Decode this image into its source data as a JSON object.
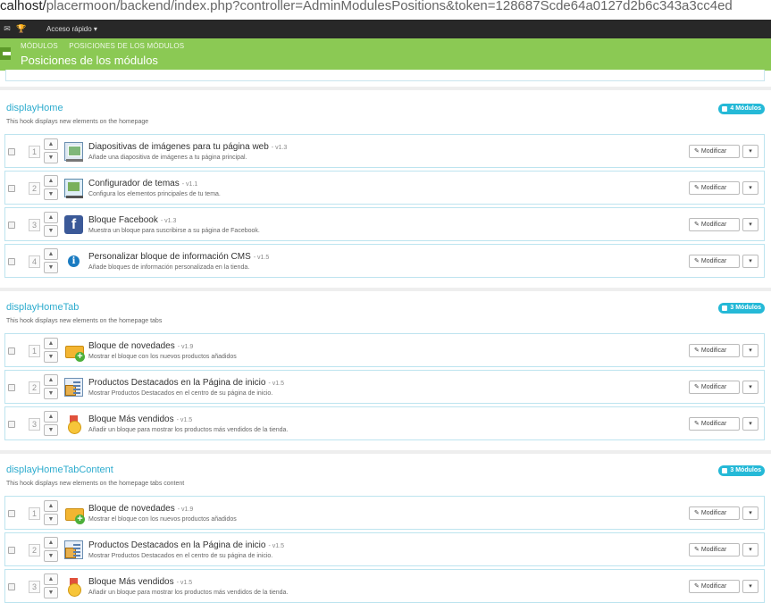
{
  "browser": {
    "url_prefix": "calhost/",
    "url_rest": "placermoon/backend/index.php?controller=AdminModulesPositions&token=128687Scde64a0127d2b6c343a3cc4ed"
  },
  "topbar": {
    "quick_access": "Acceso rápido ▾"
  },
  "header": {
    "breadcrumb": [
      "MÓDULOS",
      "POSICIONES DE LOS MÓDULOS"
    ],
    "title": "Posiciones de los módulos"
  },
  "colors": {
    "accent": "#25b9d7",
    "header_green": "#8bc954",
    "link": "#2eacce"
  },
  "sections": [
    {
      "hook": "displayHome",
      "description": "This hook displays new elements on the homepage",
      "badge": "4 Módulos",
      "modules": [
        {
          "pos": "1",
          "icon": "slideshow-icon",
          "name": "Diapositivas de imágenes para tu página web",
          "version": "- v1.3",
          "desc": "Añade una diapositiva de imágenes a tu página principal.",
          "button": "Modificar"
        },
        {
          "pos": "2",
          "icon": "theme-configurator-icon",
          "name": "Configurador de temas",
          "version": "- v1.1",
          "desc": "Configura los elementos principales de tu tema.",
          "button": "Modificar"
        },
        {
          "pos": "3",
          "icon": "facebook-icon",
          "name": "Bloque Facebook",
          "version": "- v1.3",
          "desc": "Muestra un bloque para suscribirse a su página de Facebook.",
          "button": "Modificar"
        },
        {
          "pos": "4",
          "icon": "info-icon",
          "name": "Personalizar bloque de información CMS",
          "version": "- v1.5",
          "desc": "Añade bloques de información personalizada en la tienda.",
          "button": "Modificar"
        }
      ]
    },
    {
      "hook": "displayHomeTab",
      "description": "This hook displays new elements on the homepage tabs",
      "badge": "3 Módulos",
      "modules": [
        {
          "pos": "1",
          "icon": "new-products-icon",
          "name": "Bloque de novedades",
          "version": "- v1.9",
          "desc": "Mostrar el bloque con los nuevos productos añadidos",
          "button": "Modificar"
        },
        {
          "pos": "2",
          "icon": "featured-products-icon",
          "name": "Productos Destacados en la Página de inicio",
          "version": "- v1.5",
          "desc": "Mostrar Productos Destacados en el centro de su página de inicio.",
          "button": "Modificar"
        },
        {
          "pos": "3",
          "icon": "medal-icon",
          "name": "Bloque Más vendidos",
          "version": "- v1.5",
          "desc": "Añadir un bloque para mostrar los productos más vendidos de la tienda.",
          "button": "Modificar"
        }
      ]
    },
    {
      "hook": "displayHomeTabContent",
      "description": "This hook displays new elements on the homepage tabs content",
      "badge": "3 Módulos",
      "modules": [
        {
          "pos": "1",
          "icon": "new-products-icon",
          "name": "Bloque de novedades",
          "version": "- v1.9",
          "desc": "Mostrar el bloque con los nuevos productos añadidos",
          "button": "Modificar"
        },
        {
          "pos": "2",
          "icon": "featured-products-icon",
          "name": "Productos Destacados en la Página de inicio",
          "version": "- v1.5",
          "desc": "Mostrar Productos Destacados en el centro de su página de inicio.",
          "button": "Modificar"
        },
        {
          "pos": "3",
          "icon": "medal-icon",
          "name": "Bloque Más vendidos",
          "version": "- v1.5",
          "desc": "Añadir un bloque para mostrar los productos más vendidos de la tienda.",
          "button": "Modificar"
        }
      ]
    }
  ]
}
